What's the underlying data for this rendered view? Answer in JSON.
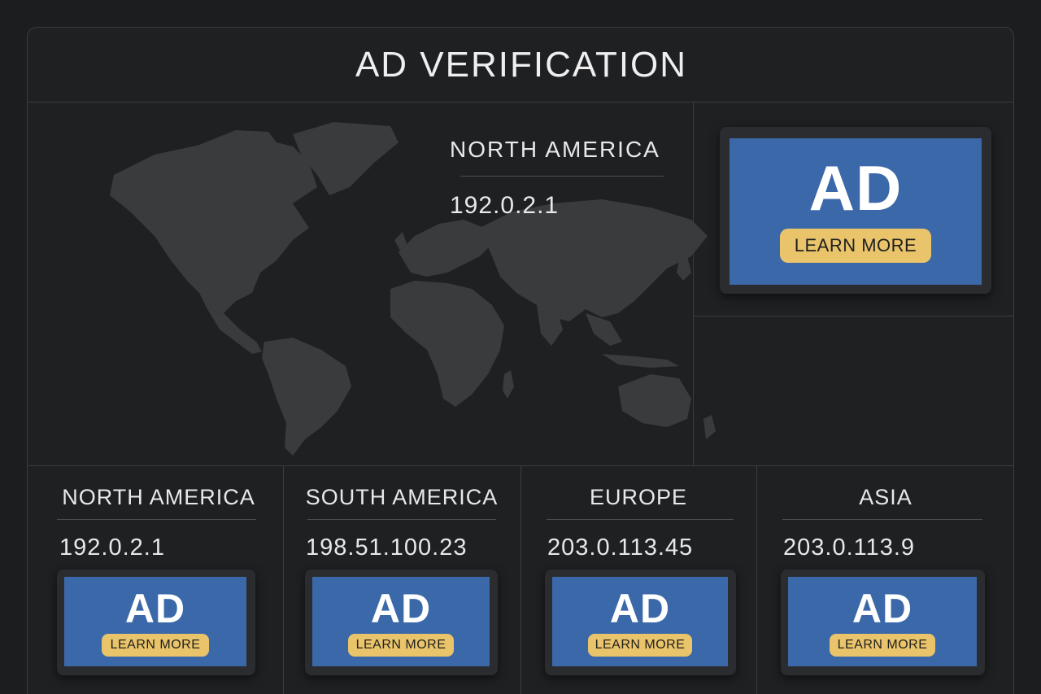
{
  "header": {
    "title": "AD VERIFICATION"
  },
  "hero": {
    "region": "NORTH AMERICA",
    "ip": "192.0.2.1",
    "ad": {
      "label": "AD",
      "button": "LEARN MORE"
    }
  },
  "regions": [
    {
      "name": "NORTH AMERICA",
      "ip": "192.0.2.1",
      "ad_label": "AD",
      "button": "LEARN MORE"
    },
    {
      "name": "SOUTH AMERICA",
      "ip": "198.51.100.23",
      "ad_label": "AD",
      "button": "LEARN MORE"
    },
    {
      "name": "EUROPE",
      "ip": "203.0.113.45",
      "ad_label": "AD",
      "button": "LEARN MORE"
    },
    {
      "name": "ASIA",
      "ip": "203.0.113.9",
      "ad_label": "AD",
      "button": "LEARN MORE"
    }
  ],
  "colors": {
    "background": "#1c1d1f",
    "ad_blue": "#3b68a8",
    "button_yellow": "#e9c46a",
    "map_fill": "#3a3b3d"
  },
  "icons": {
    "map": "world-map-icon"
  }
}
